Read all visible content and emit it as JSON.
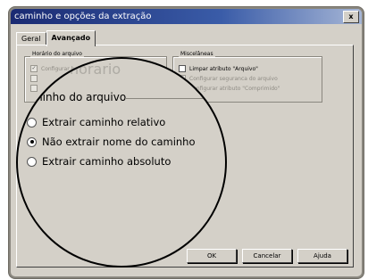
{
  "window": {
    "title": "caminho e opções da extração",
    "close_glyph": "x"
  },
  "tabs": [
    {
      "label": "Geral",
      "active": false
    },
    {
      "label": "Avançado",
      "active": true
    }
  ],
  "horario_group": {
    "label": "Horário do arquivo",
    "items": [
      {
        "label": "Configurar horário",
        "checked": true,
        "enabled": false
      },
      {
        "label": "",
        "checked": false,
        "enabled": false
      },
      {
        "label": "",
        "checked": false,
        "enabled": false
      }
    ]
  },
  "misc_group": {
    "label": "Miscelâneas",
    "items": [
      {
        "label": "Limpar atributo \"Arquivo\"",
        "checked": false,
        "enabled": true
      },
      {
        "label": "Configurar seguranca do arquivo",
        "checked": true,
        "enabled": false
      },
      {
        "label": "Configurar atributo \"Comprimido\"",
        "checked": false,
        "enabled": false
      }
    ]
  },
  "path_group": {
    "label": "caminho do arquivo",
    "ghost_text": "horario",
    "options": [
      {
        "label": "Extrair caminho relativo",
        "selected": false
      },
      {
        "label": "Não extrair nome do caminho",
        "selected": true
      },
      {
        "label": "Extrair caminho absoluto",
        "selected": false
      }
    ]
  },
  "buttons": {
    "ok": "OK",
    "cancel": "Cancelar",
    "help": "Ajuda"
  },
  "colors": {
    "dialog_face": "#d4d0c8",
    "title_gradient_start": "#1a2a72",
    "title_gradient_end": "#a6b6d6",
    "lens_border": "#000000"
  }
}
